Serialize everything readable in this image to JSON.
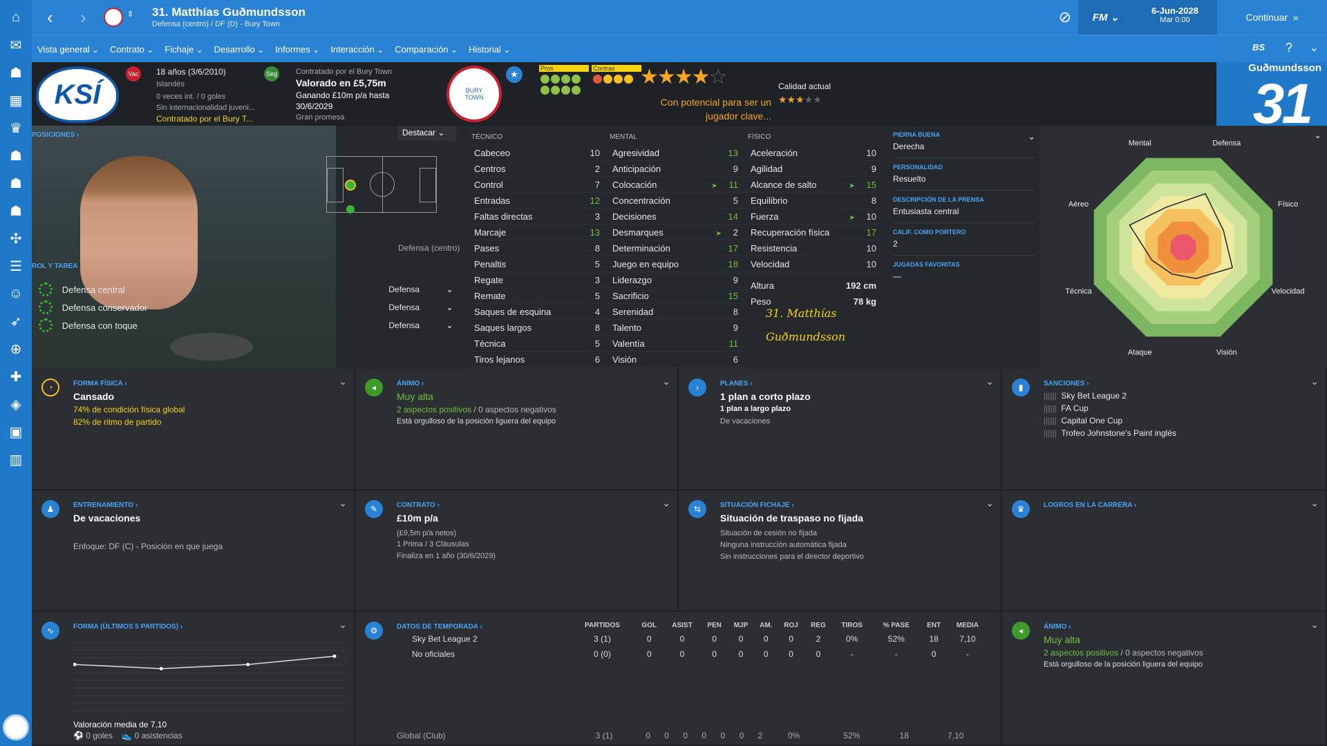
{
  "app": {
    "player_title": "31. Matthías Guðmundsson",
    "subtitle": "Defensa (centro) / DF (D) - Bury Town"
  },
  "nav": [
    "Vista general",
    "Contrato",
    "Fichaje",
    "Desarrollo",
    "Informes",
    "Interacción",
    "Comparación",
    "Historial"
  ],
  "topright": {
    "date": "6-Jun-2028",
    "day": "Mar 0:00",
    "logo": "FM",
    "continue": "Continuar",
    "badge": "BS"
  },
  "header": {
    "ksi": "KSÍ",
    "age": "18 años (3/6/2010)",
    "nation": "Islandés",
    "caps": "0 veces int. / 0 goles",
    "intl": "Sin internacionalidad juveni...",
    "contracted_short": "Contratado por el Bury T...",
    "badge_vac": "Vac",
    "badge_seg": "Seg",
    "contracted_by": "Contratado por el Bury Town",
    "value": "Valorado en £5,75m",
    "wage": "Ganando £10m p/a hasta",
    "until": "30/6/2029",
    "status": "Gran promesa",
    "pros": "Pros",
    "contras": "Contras",
    "potential": "Con potencial para ser un jugador clave...",
    "calidad": "Calidad actual",
    "number_name": "Guðmundsson",
    "number": "31"
  },
  "positions": {
    "label": "POSICIONES",
    "dropdown": "Destacar",
    "pos_label": "Defensa (centro)",
    "rol_label": "ROL Y TAREA",
    "roles": [
      {
        "name": "Defensa central",
        "duty": "Defensa"
      },
      {
        "name": "Defensa conservador",
        "duty": "Defensa"
      },
      {
        "name": "Defensa con toque",
        "duty": "Defensa"
      }
    ]
  },
  "attributes": {
    "tecnico_label": "TÉCNICO",
    "mental_label": "MENTAL",
    "fisico_label": "FÍSICO",
    "tecnico": [
      {
        "name": "Cabeceo",
        "value": "10",
        "green": false
      },
      {
        "name": "Centros",
        "value": "2",
        "green": false
      },
      {
        "name": "Control",
        "value": "7",
        "green": false
      },
      {
        "name": "Entradas",
        "value": "12",
        "green": true
      },
      {
        "name": "Faltas directas",
        "value": "3",
        "green": false
      },
      {
        "name": "Marcaje",
        "value": "13",
        "green": true
      },
      {
        "name": "Pases",
        "value": "8",
        "green": false
      },
      {
        "name": "Penaltis",
        "value": "5",
        "green": false
      },
      {
        "name": "Regate",
        "value": "3",
        "green": false
      },
      {
        "name": "Remate",
        "value": "5",
        "green": false
      },
      {
        "name": "Saques de esquina",
        "value": "4",
        "green": false
      },
      {
        "name": "Saques largos",
        "value": "8",
        "green": false
      },
      {
        "name": "Técnica",
        "value": "5",
        "green": false
      },
      {
        "name": "Tiros lejanos",
        "value": "6",
        "green": false
      }
    ],
    "mental": [
      {
        "name": "Agresividad",
        "value": "13",
        "green": true
      },
      {
        "name": "Anticipación",
        "value": "9",
        "green": false
      },
      {
        "name": "Colocación",
        "value": "11",
        "green": true,
        "arrow": true
      },
      {
        "name": "Concentración",
        "value": "5",
        "green": false
      },
      {
        "name": "Decisiones",
        "value": "14",
        "green": true
      },
      {
        "name": "Desmarques",
        "value": "2",
        "green": false,
        "arrow": true
      },
      {
        "name": "Determinación",
        "value": "17",
        "green": true
      },
      {
        "name": "Juego en equipo",
        "value": "18",
        "green": true
      },
      {
        "name": "Liderazgo",
        "value": "9",
        "green": false
      },
      {
        "name": "Sacrificio",
        "value": "15",
        "green": true
      },
      {
        "name": "Serenidad",
        "value": "8",
        "green": false
      },
      {
        "name": "Talento",
        "value": "9",
        "green": false
      },
      {
        "name": "Valentía",
        "value": "11",
        "green": true
      },
      {
        "name": "Visión",
        "value": "6",
        "green": false
      }
    ],
    "fisico": [
      {
        "name": "Aceleración",
        "value": "10",
        "green": false
      },
      {
        "name": "Agilidad",
        "value": "9",
        "green": false
      },
      {
        "name": "Alcance de salto",
        "value": "15",
        "green": true,
        "arrow": true
      },
      {
        "name": "Equilibrio",
        "value": "8",
        "green": false
      },
      {
        "name": "Fuerza",
        "value": "10",
        "green": false,
        "arrow": true
      },
      {
        "name": "Recuperación física",
        "value": "17",
        "green": true
      },
      {
        "name": "Resistencia",
        "value": "10",
        "green": false
      },
      {
        "name": "Velocidad",
        "value": "10",
        "green": false
      }
    ],
    "altura_label": "Altura",
    "altura": "192 cm",
    "peso_label": "Peso",
    "peso": "78 kg",
    "signature1": "31. Matthías",
    "signature2": "Guðmundsson"
  },
  "info": [
    {
      "label": "PIERNA BUENA",
      "value": "Derecha"
    },
    {
      "label": "PERSONALIDAD",
      "value": "Resuelto"
    },
    {
      "label": "DESCRIPCIÓN DE LA PRENSA",
      "value": "Entusiasta central"
    },
    {
      "label": "CALIF. COMO PORTERO",
      "value": "2"
    },
    {
      "label": "JUGADAS FAVORITAS",
      "value": "—"
    }
  ],
  "radar": {
    "labels": [
      "Defensa",
      "Físico",
      "Velocidad",
      "Visión",
      "Ataque",
      "Técnica",
      "Aéreo",
      "Mental"
    ],
    "values": [
      0.6,
      0.45,
      0.55,
      0.35,
      0.3,
      0.35,
      0.6,
      0.45
    ],
    "colors": [
      "#7cb660",
      "#a4d07c",
      "#cde49a",
      "#f0e9a0",
      "#f5c060",
      "#f0903c",
      "#e8576a"
    ]
  },
  "panels": {
    "forma": {
      "label": "FORMA FÍSICA",
      "title": "Cansado",
      "l1": "74% de condición física global",
      "l2": "82% de ritmo de partido"
    },
    "animo": {
      "label": "ÁNIMO",
      "title": "Muy alta",
      "pos": "2 aspectos positivos",
      "sep": "/",
      "neg": "0 aspectos negativos",
      "note": "Está orgulloso de la posición liguera del equipo"
    },
    "planes": {
      "label": "PLANES",
      "title": "1 plan a corto plazo",
      "l1": "1 plan a largo plazo",
      "l2": "De vacaciones"
    },
    "sanciones": {
      "label": "SANCIONES",
      "items": [
        "Sky Bet League 2",
        "FA Cup",
        "Capital One Cup",
        "Trofeo Johnstone's Paint inglés"
      ]
    },
    "entrenamiento": {
      "label": "ENTRENAMIENTO",
      "title": "De vacaciones",
      "l1": "Enfoque: DF (C) - Posición en que juega"
    },
    "contrato": {
      "label": "CONTRATO",
      "title": "£10m p/a",
      "l1": "(£9,5m p/a netos)",
      "l2": "1 Prima / 3 Cláusulas",
      "l3": "Finaliza en 1 año  (30/6/2029)"
    },
    "fichaje": {
      "label": "SITUACIÓN FICHAJE",
      "title": "Situación de traspaso no fijada",
      "l1": "Situación de cesión no fijada",
      "l2": "Ninguna instrucción automática fijada",
      "l3": "Sin instrucciones para el director deportivo"
    },
    "logros": {
      "label": "LOGROS EN LA CARRERA"
    },
    "forma5": {
      "label": "FORMA (ÚLTIMOS 5 PARTIDOS)",
      "avg": "Valoración media de 7,10",
      "goles": "0 goles",
      "asist": "0 asistencias",
      "ratings": [
        7.0,
        6.9,
        7.0,
        7.2
      ]
    },
    "temporada": {
      "label": "DATOS DE TEMPORADA",
      "headers": [
        "",
        "PARTIDOS",
        "GOL",
        "ASIST",
        "PEN",
        "MJP",
        "AM.",
        "ROJ",
        "REG",
        "TIROS",
        "% PASE",
        "ENT",
        "MEDIA"
      ],
      "rows": [
        [
          "Sky Bet League 2",
          "3 (1)",
          "0",
          "0",
          "0",
          "0",
          "0",
          "0",
          "2",
          "0%",
          "52%",
          "18",
          "7,10"
        ],
        [
          "No oficiales",
          "0 (0)",
          "0",
          "0",
          "0",
          "0",
          "0",
          "0",
          "0",
          "-",
          "-",
          "0",
          "-"
        ]
      ],
      "total": [
        "Global (Club)",
        "3 (1)",
        "0",
        "0",
        "0",
        "0",
        "0",
        "0",
        "2",
        "0%",
        "52%",
        "18",
        "7,10"
      ]
    },
    "animo2": {
      "label": "ÁNIMO",
      "title": "Muy alta",
      "pos": "2 aspectos positivos",
      "sep": "/",
      "neg": "0 aspectos negativos",
      "note": "Está orgulloso de la posición liguera del equipo"
    }
  }
}
